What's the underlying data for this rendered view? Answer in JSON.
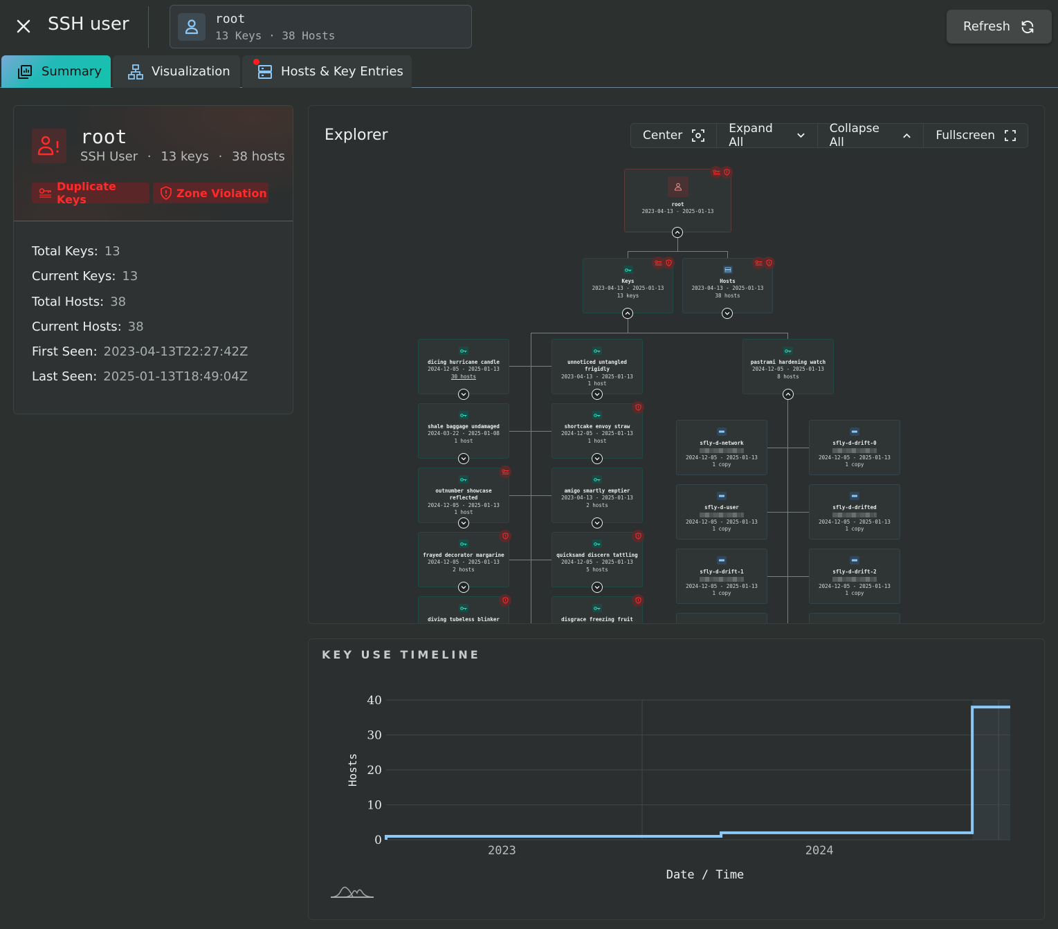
{
  "header": {
    "title": "SSH user",
    "entity_name": "root",
    "entity_meta": "13 Keys · 38 Hosts",
    "refresh_label": "Refresh"
  },
  "tabs": [
    {
      "label": "Summary",
      "active": true
    },
    {
      "label": "Visualization",
      "active": false
    },
    {
      "label": "Hosts & Key Entries",
      "active": false,
      "notification": true
    }
  ],
  "summary": {
    "name": "root",
    "type": "SSH User",
    "keys": "13 keys",
    "hosts": "38 hosts",
    "separator": "·",
    "badges": [
      {
        "label": "Duplicate Keys",
        "icon": "duplicate-key-icon"
      },
      {
        "label": "Zone Violation",
        "icon": "shield-alert-icon"
      }
    ],
    "stats": [
      {
        "label": "Total Keys:",
        "value": "13"
      },
      {
        "label": "Current Keys:",
        "value": "13"
      },
      {
        "label": "Total Hosts:",
        "value": "38"
      },
      {
        "label": "Current Hosts:",
        "value": "38"
      },
      {
        "label": "First Seen:",
        "value": "2023-04-13T22:27:42Z"
      },
      {
        "label": "Last Seen:",
        "value": "2025-01-13T18:49:04Z"
      }
    ]
  },
  "explorer": {
    "title": "Explorer",
    "toolbar": [
      {
        "label": "Center",
        "icon": "focus-icon"
      },
      {
        "label": "Expand All",
        "icon": "chevron-down-icon"
      },
      {
        "label": "Collapse All",
        "icon": "chevron-up-icon"
      },
      {
        "label": "Fullscreen",
        "icon": "fullscreen-icon"
      }
    ],
    "root": {
      "name": "root",
      "dates": "2023-04-13 - 2025-01-13"
    },
    "groups": [
      {
        "name": "Keys",
        "dates": "2023-04-13 - 2025-01-13",
        "count": "13 keys"
      },
      {
        "name": "Hosts",
        "dates": "2023-04-13 - 2025-01-13",
        "count": "38 hosts"
      }
    ],
    "keys": [
      {
        "name": "dicing hurricane candle",
        "dates": "2024-12-05 - 2025-01-13",
        "count": "30 hosts",
        "alert": ""
      },
      {
        "name": "unnoticed untangled frigidly",
        "dates": "2023-04-13 - 2025-01-13",
        "count": "1 host",
        "alert": ""
      },
      {
        "name": "pastrami hardening watch",
        "dates": "2024-12-05 - 2025-01-13",
        "count": "8 hosts",
        "alert": ""
      },
      {
        "name": "shale baggage undamaged",
        "dates": "2024-03-22 - 2025-01-08",
        "count": "1 host",
        "alert": ""
      },
      {
        "name": "shortcake envoy straw",
        "dates": "2024-12-05 - 2025-01-13",
        "count": "1 host",
        "alert": "zone"
      },
      {
        "name": "outnumber showcase reflected",
        "dates": "2024-12-05 - 2025-01-13",
        "count": "1 host",
        "alert": "dup"
      },
      {
        "name": "amigo smartly emptier",
        "dates": "2023-04-13 - 2025-01-13",
        "count": "2 hosts",
        "alert": ""
      },
      {
        "name": "frayed decorator margarine",
        "dates": "2024-12-05 - 2025-01-13",
        "count": "2 hosts",
        "alert": "zone"
      },
      {
        "name": "quicksand discern tattling",
        "dates": "2024-12-05 - 2025-01-13",
        "count": "5 hosts",
        "alert": "zone"
      },
      {
        "name": "diving tubeless blinker",
        "dates": "",
        "count": "",
        "alert": "zone"
      },
      {
        "name": "disgrace freezing fruit",
        "dates": "",
        "count": "",
        "alert": "zone"
      }
    ],
    "hosts": [
      {
        "name": "sfly-d-network",
        "dates": "2024-12-05 - 2025-01-13",
        "count": "1 copy"
      },
      {
        "name": "sfly-d-drift-0",
        "dates": "2024-12-05 - 2025-01-13",
        "count": "1 copy"
      },
      {
        "name": "sfly-d-user",
        "dates": "2024-12-05 - 2025-01-13",
        "count": "1 copy"
      },
      {
        "name": "sfly-d-drifted",
        "dates": "2024-12-05 - 2025-01-13",
        "count": "1 copy"
      },
      {
        "name": "sfly-d-drift-1",
        "dates": "2024-12-05 - 2025-01-13",
        "count": "1 copy"
      },
      {
        "name": "sfly-d-drift-2",
        "dates": "2024-12-05 - 2025-01-13",
        "count": "1 copy"
      }
    ]
  },
  "timeline": {
    "title": "KEY USE TIMELINE"
  },
  "colors": {
    "accent": "#14c2ad",
    "danger": "#ff2b2b",
    "line": "#8cc8f5",
    "background": "#2c302f"
  },
  "chart_data": {
    "type": "line",
    "step": true,
    "title": "KEY USE TIMELINE",
    "xlabel": "Date / Time",
    "ylabel": "Hosts",
    "ylim": [
      0,
      40
    ],
    "yticks": [
      0,
      10,
      20,
      30,
      40
    ],
    "xticks": [
      "2023",
      "2024"
    ],
    "xlim": [
      "2023-04-13",
      "2025-01-13"
    ],
    "grid": true,
    "series": [
      {
        "name": "Hosts",
        "x": [
          "2023-04-13",
          "2024-03-22",
          "2024-12-05",
          "2025-01-13"
        ],
        "values": [
          1,
          2,
          38,
          38
        ]
      }
    ],
    "highlight_range": [
      "2024-12-05",
      "2025-01-13"
    ]
  }
}
